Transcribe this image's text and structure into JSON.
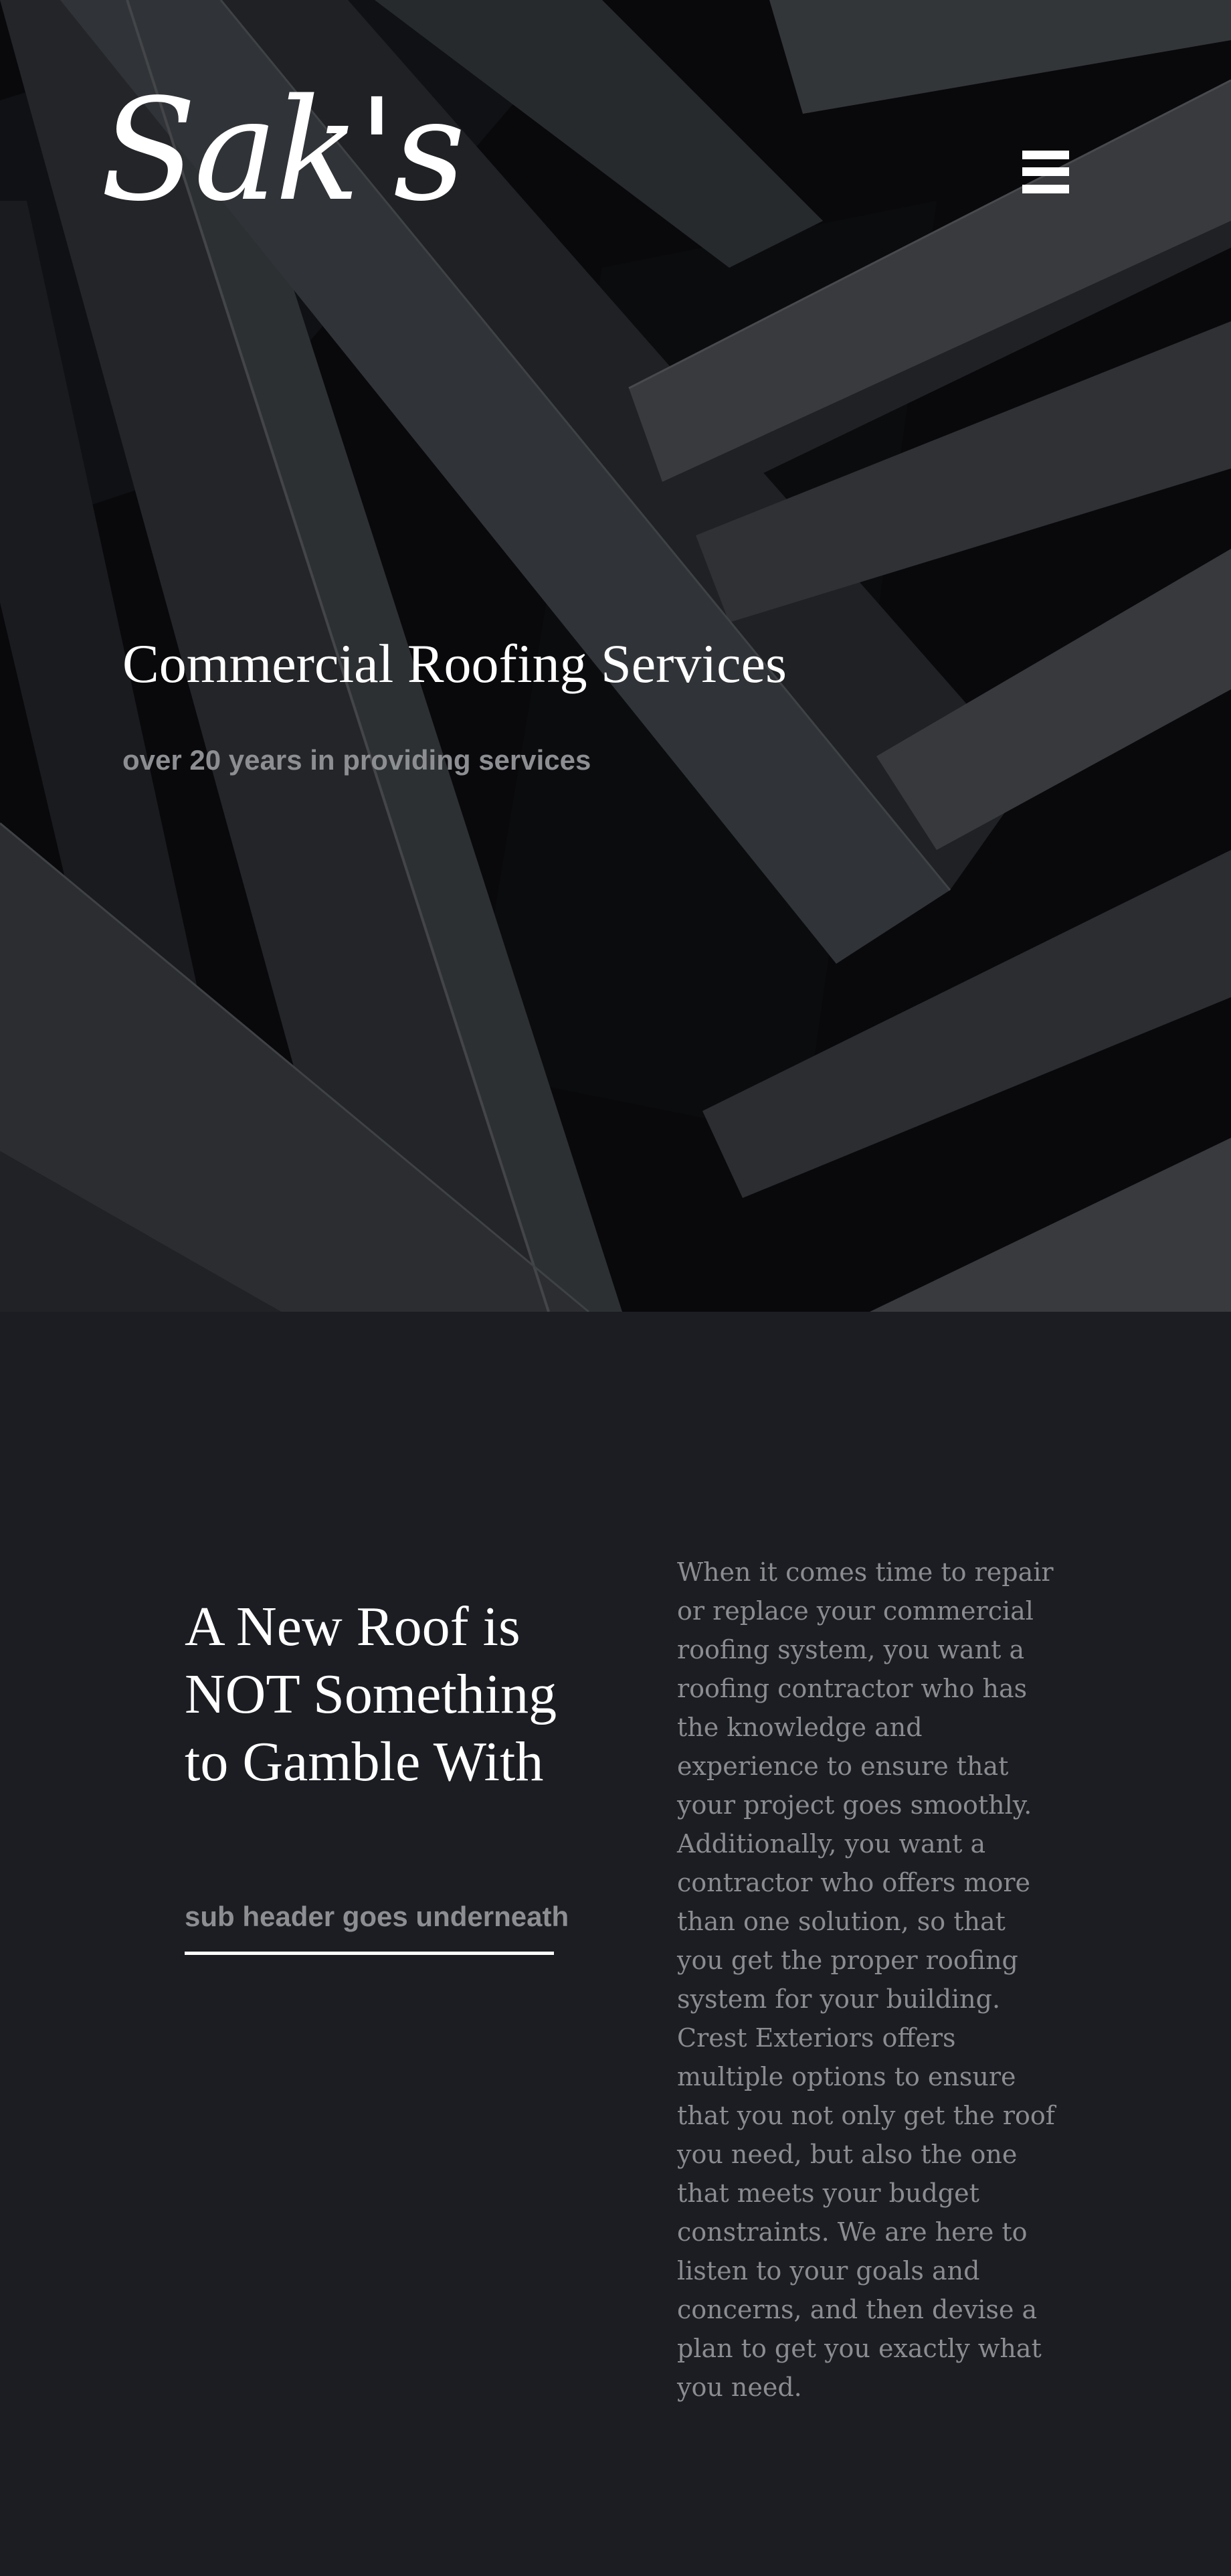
{
  "header": {
    "logo_text": "Sak's",
    "menu_icon": "hamburger-menu-icon"
  },
  "hero": {
    "title": "Commercial Roofing Services",
    "subtitle": "over 20 years in providing services",
    "background_image": "dark angular architecture building"
  },
  "intro": {
    "title": "A New Roof is NOT Something to Gamble With",
    "subheader": "sub header goes underneath",
    "body": "When it comes time to repair or replace your commercial roofing system, you want a roofing contractor who has the knowledge and experience to ensure that your project goes smoothly. Additionally, you want a contractor who offers more than one solution, so that you get the proper roofing system for your building. Crest Exteriors offers multiple options to ensure that you not only get the roof you need, but also the one that meets your budget constraints. We are here to listen to your goals and concerns, and then devise a plan to get you exactly what you need."
  },
  "colors": {
    "page_background": "#1b1d23",
    "hero_background": "#0d0e11",
    "heading_text": "#ffffff",
    "muted_text": "#8c8e92",
    "body_text": "#8a8c90"
  }
}
